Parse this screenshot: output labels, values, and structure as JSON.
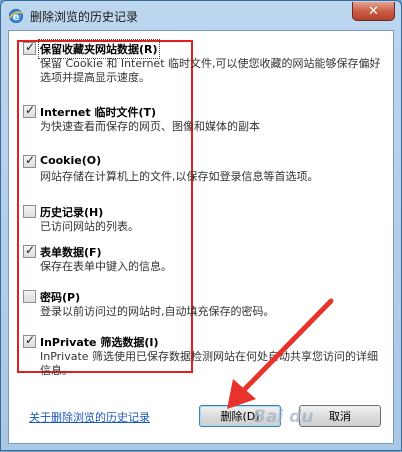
{
  "window": {
    "title": "删除浏览的历史记录",
    "close_symbol": "✕"
  },
  "options": [
    {
      "label": "保留收藏夹网站数据(R)",
      "checked": true,
      "description": "保留 Cookie 和 Internet 临时文件,可以使您收藏的网站能够保存偏好选项并提高显示速度。"
    },
    {
      "label": "Internet 临时文件(T)",
      "checked": true,
      "description": "为快速查看而保存的网页、图像和媒体的副本"
    },
    {
      "label": "Cookie(O)",
      "checked": true,
      "description": "网站存储在计算机上的文件,以保存如登录信息等首选项。"
    },
    {
      "label": "历史记录(H)",
      "checked": false,
      "description": "已访问网站的列表。"
    },
    {
      "label": "表单数据(F)",
      "checked": true,
      "description": "保存在表单中键入的信息。"
    },
    {
      "label": "密码(P)",
      "checked": false,
      "description": "登录以前访问过的网站时,自动填充保存的密码。"
    },
    {
      "label": "InPrivate 筛选数据(I)",
      "checked": true,
      "description": "InPrivate 筛选使用已保存数据检测网站在何处自动共享您访问的详细信息。"
    }
  ],
  "footer": {
    "help_link": "关于删除浏览的历史记录",
    "delete_button": "删除(D)",
    "cancel_button": "取消"
  },
  "watermark_text": "Bai du",
  "accent_colors": {
    "highlight_box": "#e02020",
    "arrow": "#e8322c",
    "link": "#1c5ab4"
  }
}
